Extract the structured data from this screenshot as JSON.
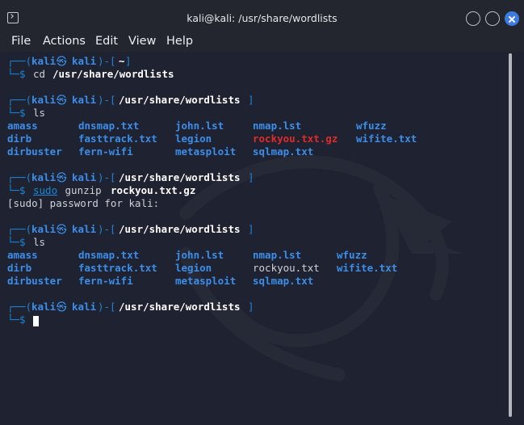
{
  "window": {
    "title": "kali@kali: /usr/share/wordlists",
    "buttons": [
      "minimize-button",
      "maximize-button",
      "close-button"
    ]
  },
  "menu": [
    "File",
    "Actions",
    "Edit",
    "View",
    "Help"
  ],
  "terminal": {
    "p1": {
      "top": "┌──(",
      "user": "kali",
      "at": "㉿",
      "host": "kali",
      "mid": ")-[",
      "path": "~",
      "end": "]",
      "bottom": "└─$ ",
      "cmd_a": "cd ",
      "cmd_b": "/usr/share/wordlists"
    },
    "p2": {
      "top": "┌──(",
      "user": "kali",
      "at": "㉿",
      "host": "kali",
      "mid": ")-[",
      "path": "/usr/share/wordlists",
      "end": "]",
      "bottom": "└─$ ",
      "cmd_a": "ls"
    },
    "ls1": [
      [
        "amass",
        "dnsmap.txt",
        "john.lst",
        "nmap.lst",
        "wfuzz"
      ],
      [
        "dirb",
        "fasttrack.txt",
        "legion",
        "rockyou.txt.gz",
        "wifite.txt"
      ],
      [
        "dirbuster",
        "fern-wifi",
        "metasploit",
        "sqlmap.txt",
        ""
      ]
    ],
    "p3": {
      "top": "┌──(",
      "user": "kali",
      "at": "㉿",
      "host": "kali",
      "mid": ")-[",
      "path": "/usr/share/wordlists",
      "end": "]",
      "bottom": "└─$ ",
      "cmd_sudo": "sudo",
      "cmd_b": " gunzip ",
      "cmd_c": "rockyou.txt.gz"
    },
    "sudo_prompt": "[sudo] password for kali:",
    "p4": {
      "top": "┌──(",
      "user": "kali",
      "at": "㉿",
      "host": "kali",
      "mid": ")-[",
      "path": "/usr/share/wordlists",
      "end": "]",
      "bottom": "└─$ ",
      "cmd_a": "ls"
    },
    "ls2": [
      [
        "amass",
        "dnsmap.txt",
        "john.lst",
        "nmap.lst",
        "wfuzz"
      ],
      [
        "dirb",
        "fasttrack.txt",
        "legion",
        "rockyou.txt",
        "wifite.txt"
      ],
      [
        "dirbuster",
        "fern-wifi",
        "metasploit",
        "sqlmap.txt",
        ""
      ]
    ],
    "p5": {
      "top": "┌──(",
      "user": "kali",
      "at": "㉿",
      "host": "kali",
      "mid": ")-[",
      "path": "/usr/share/wordlists",
      "end": "]",
      "bottom": "└─$ "
    }
  },
  "colors": {
    "prompt": "#1c86d6",
    "dir": "#3b8eea",
    "archive": "#e12b2b",
    "background": "#1f2230"
  }
}
